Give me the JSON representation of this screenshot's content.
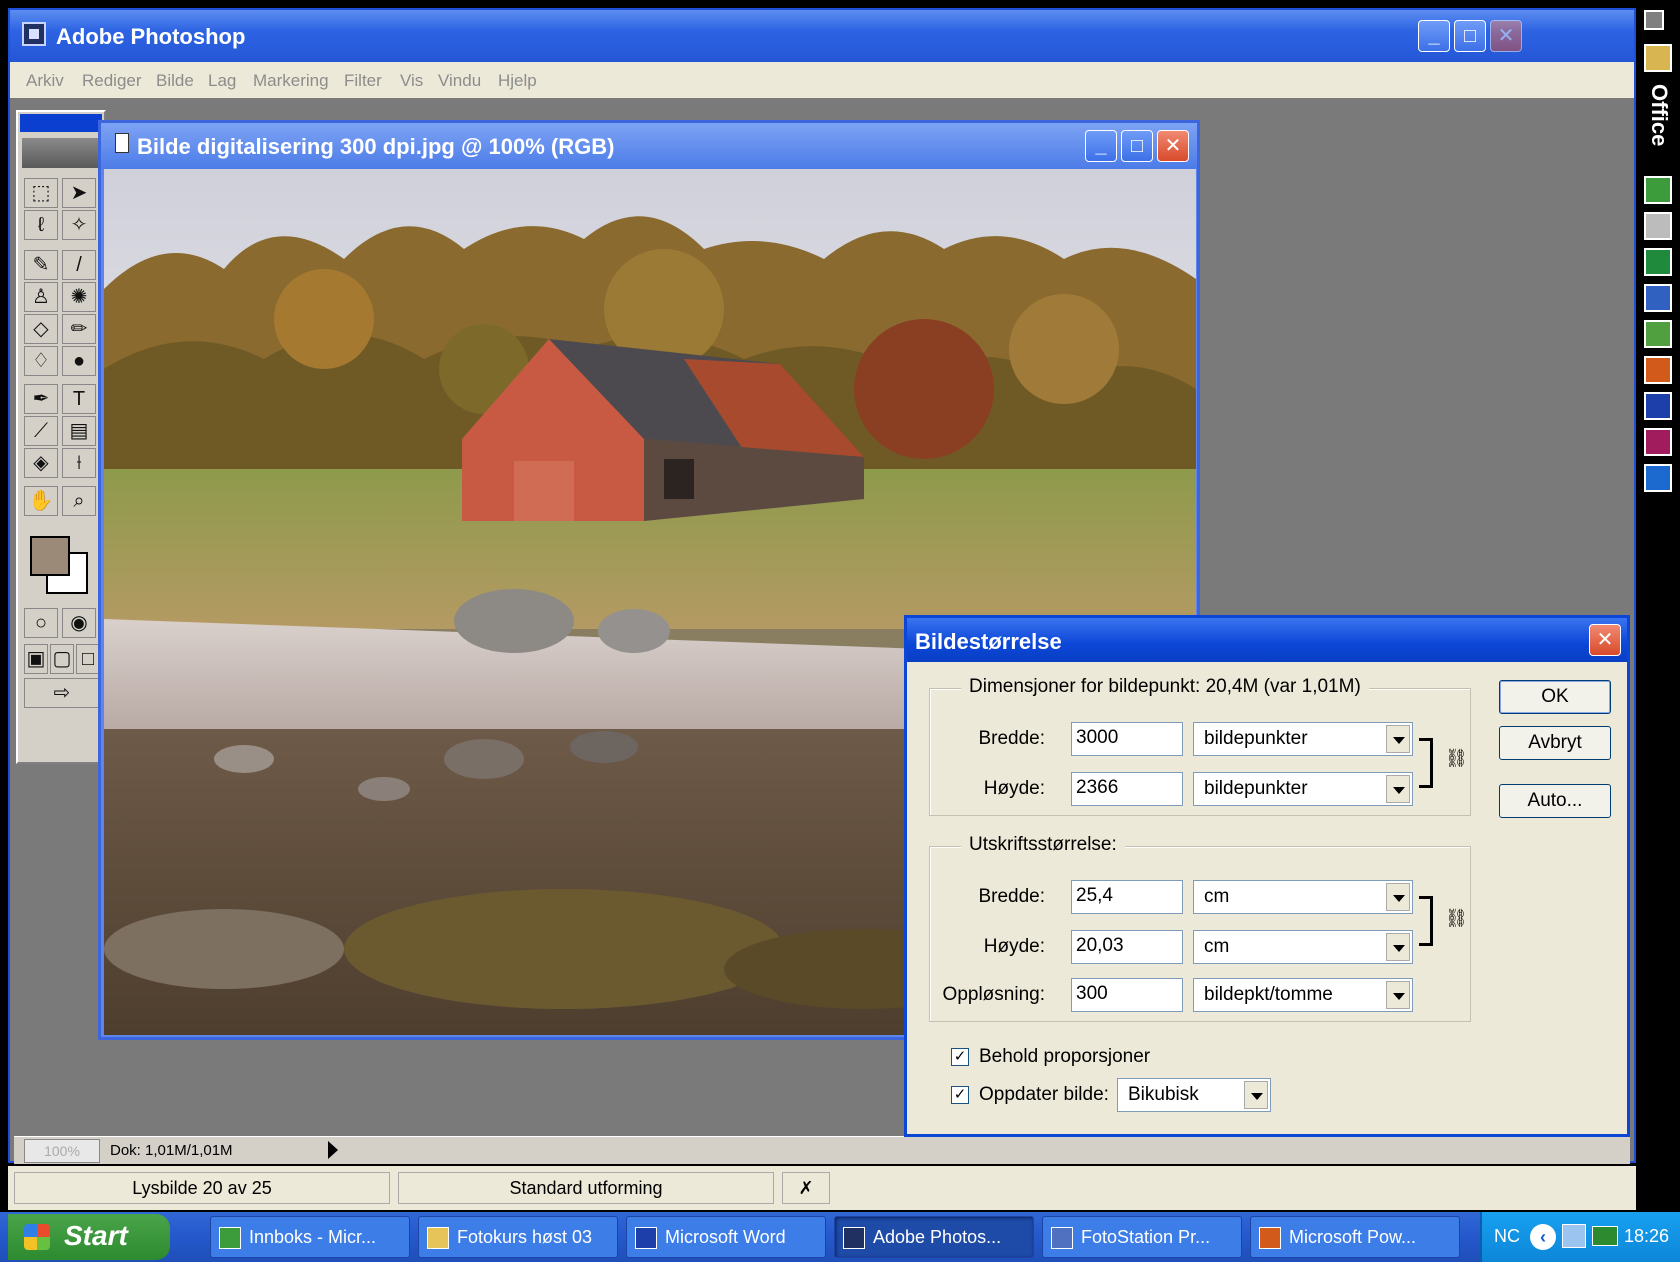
{
  "app": {
    "title": "Adobe Photoshop",
    "menu": [
      "Arkiv",
      "Rediger",
      "Bilde",
      "Lag",
      "Markering",
      "Filter",
      "Vis",
      "Vindu",
      "Hjelp"
    ]
  },
  "document": {
    "title": "Bilde digitalisering 300 dpi.jpg @ 100% (RGB)",
    "zoom": "100%",
    "doc_size": "Dok: 1,01M/1,01M"
  },
  "dialog": {
    "title": "Bildestørrelse",
    "pixel_dimensions_label": "Dimensjoner for bildepunkt:  20,4M (var 1,01M)",
    "pixel": {
      "width_label": "Bredde:",
      "width_value": "3000",
      "width_unit": "bildepunkter",
      "height_label": "Høyde:",
      "height_value": "2366",
      "height_unit": "bildepunkter"
    },
    "print_size_label": "Utskriftsstørrelse:",
    "print": {
      "width_label": "Bredde:",
      "width_value": "25,4",
      "width_unit": "cm",
      "height_label": "Høyde:",
      "height_value": "20,03",
      "height_unit": "cm",
      "resolution_label": "Oppløsning:",
      "resolution_value": "300",
      "resolution_unit": "bildepkt/tomme"
    },
    "keep_proportions_label": "Behold proporsjoner",
    "keep_proportions_checked": true,
    "update_image_label": "Oppdater bilde:",
    "update_image_checked": true,
    "resample_method": "Bikubisk",
    "buttons": {
      "ok": "OK",
      "cancel": "Avbryt",
      "auto": "Auto..."
    }
  },
  "powerpoint_status": {
    "slide": "Lysbilde 20 av 25",
    "design": "Standard utforming"
  },
  "taskbar": {
    "start": "Start",
    "tasks": [
      {
        "label": "Innboks - Micr...",
        "icon": "outlook-icon",
        "active": false
      },
      {
        "label": "Fotokurs høst 03",
        "icon": "folder-icon",
        "active": false
      },
      {
        "label": "Microsoft Word",
        "icon": "word-icon",
        "active": false
      },
      {
        "label": "Adobe Photos...",
        "icon": "photoshop-icon",
        "active": true
      },
      {
        "label": "FotoStation Pr...",
        "icon": "fotostation-icon",
        "active": false
      },
      {
        "label": "Microsoft Pow...",
        "icon": "powerpoint-icon",
        "active": false
      }
    ],
    "tray_lang": "NC",
    "clock": "18:26"
  },
  "office_bar": {
    "label": "Office"
  }
}
